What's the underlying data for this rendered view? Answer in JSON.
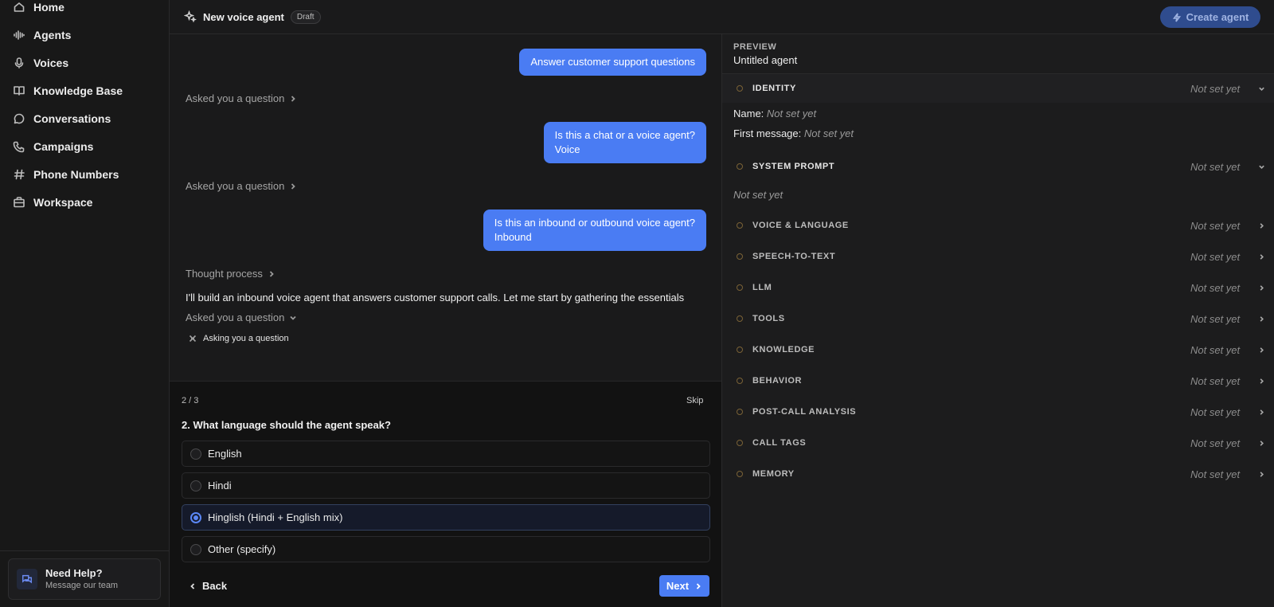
{
  "sidebar": {
    "items": [
      {
        "label": "Home",
        "icon": "home-icon"
      },
      {
        "label": "Agents",
        "icon": "waveform-icon"
      },
      {
        "label": "Voices",
        "icon": "microphone-icon"
      },
      {
        "label": "Knowledge Base",
        "icon": "book-icon"
      },
      {
        "label": "Conversations",
        "icon": "chat-bubble-icon"
      },
      {
        "label": "Campaigns",
        "icon": "phone-icon"
      },
      {
        "label": "Phone Numbers",
        "icon": "hash-icon"
      },
      {
        "label": "Workspace",
        "icon": "briefcase-icon"
      }
    ],
    "help": {
      "title": "Need Help?",
      "subtitle": "Message our team"
    }
  },
  "header": {
    "title": "New voice agent",
    "badge": "Draft",
    "create_label": "Create agent"
  },
  "chat": {
    "msg1": "Answer customer support questions",
    "asked1": "Asked you a question",
    "msg2_line1": "Is this a chat or a voice agent?",
    "msg2_line2": "Voice",
    "asked2": "Asked you a question",
    "msg3_line1": "Is this an inbound or outbound voice agent?",
    "msg3_line2": "Inbound",
    "thought": "Thought process",
    "assistant_text": "I'll build an inbound voice agent that answers customer support calls. Let me start by gathering the essentials",
    "asked3": "Asked you a question",
    "asking": "Asking you a question"
  },
  "question": {
    "progress": "2 / 3",
    "skip_label": "Skip",
    "text": "2. What language should the agent speak?",
    "options": [
      {
        "label": "English",
        "selected": false
      },
      {
        "label": "Hindi",
        "selected": false
      },
      {
        "label": "Hinglish (Hindi + English mix)",
        "selected": true
      },
      {
        "label": "Other (specify)",
        "selected": false
      }
    ],
    "back_label": "Back",
    "next_label": "Next"
  },
  "preview": {
    "label": "PREVIEW",
    "agent_name": "Untitled agent",
    "identity": {
      "title": "IDENTITY",
      "status": "Not set yet",
      "name_label": "Name:",
      "name_value": "Not set yet",
      "first_message_label": "First message:",
      "first_message_value": "Not set yet"
    },
    "system_prompt": {
      "title": "SYSTEM PROMPT",
      "status": "Not set yet",
      "value": "Not set yet"
    },
    "sections": [
      {
        "title": "VOICE & LANGUAGE",
        "status": "Not set yet"
      },
      {
        "title": "SPEECH-TO-TEXT",
        "status": "Not set yet"
      },
      {
        "title": "LLM",
        "status": "Not set yet"
      },
      {
        "title": "TOOLS",
        "status": "Not set yet"
      },
      {
        "title": "KNOWLEDGE",
        "status": "Not set yet"
      },
      {
        "title": "BEHAVIOR",
        "status": "Not set yet"
      },
      {
        "title": "POST-CALL ANALYSIS",
        "status": "Not set yet"
      },
      {
        "title": "CALL TAGS",
        "status": "Not set yet"
      },
      {
        "title": "MEMORY",
        "status": "Not set yet"
      }
    ]
  },
  "colors": {
    "accent": "#4a7cf3",
    "background": "#1a1a1b",
    "status_dot": "#7a6236"
  }
}
